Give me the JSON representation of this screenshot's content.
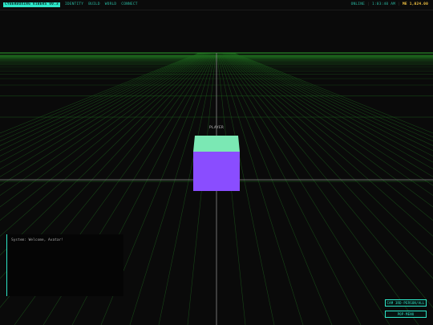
{
  "topbar": {
    "brand": "CYBERBOXING VIBERS V0.3",
    "nav": [
      "IDENTITY",
      "BUILD",
      "WORLD",
      "CONNECT"
    ],
    "status_online": "ONLINE",
    "separator": "|",
    "time": "1:03:40 AM",
    "balance": "ME 1,024.00"
  },
  "scene": {
    "player_label": "PLAYER",
    "grid_color": "#1f6b1f",
    "horizon_color": "#2fa82f",
    "axis_color": "#8a8a8a",
    "cube_top_color": "#7be8b4",
    "cube_front_color": "#8a4dff"
  },
  "chat": {
    "message": "System: Welcome, Avatar!"
  },
  "buttons": {
    "camera": "CAM 3RD-PERSON/ALL",
    "popmenu": "POP-MENU"
  },
  "colors": {
    "accent": "#2ee6c8",
    "balance": "#f5c542",
    "background": "#0a0a0a"
  }
}
